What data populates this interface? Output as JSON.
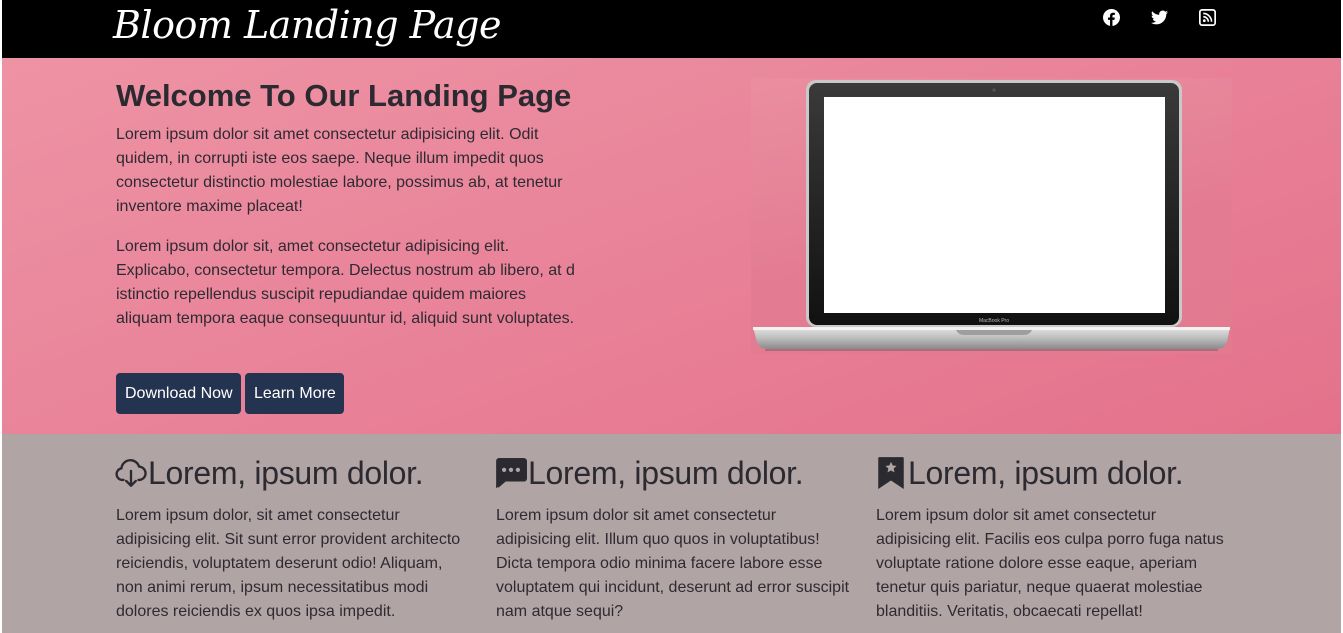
{
  "navbar": {
    "brand": "Bloom Landing Page",
    "social": [
      {
        "icon": "facebook-icon"
      },
      {
        "icon": "twitter-icon"
      },
      {
        "icon": "rss-icon"
      }
    ]
  },
  "hero": {
    "title": "Welcome To Our Landing Page",
    "paragraphs": [
      "Lorem ipsum dolor sit amet consectetur adipisicing elit. Odit quidem, in corrupti iste eos saepe. Neque illum impedit quos consectetur distinctio molestiae labore, possimus ab, at tenetur inventore maxime placeat!",
      "Lorem ipsum dolor sit, amet consectetur adipisicing elit. Explicabo, consectetur tempora. Delectus nostrum ab libero, at d istinctio repellendus suscipit repudiandae quidem maiores aliquam tempora eaque consequuntur id, aliquid sunt voluptates."
    ],
    "download_label": "Download Now",
    "learn_label": "Learn More",
    "image": {
      "icon": "laptop-illustration",
      "screen_label": "MacBook Pro"
    }
  },
  "features": [
    {
      "icon": "cloud-download-icon",
      "title": "Lorem, ipsum dolor.",
      "text": "Lorem ipsum dolor, sit amet consectetur adipisicing elit. Sit sunt error provident architecto reiciendis, voluptatem deserunt odio! Aliquam, non animi rerum, ipsum necessitatibus modi dolores reiciendis ex quos ipsa impedit."
    },
    {
      "icon": "chat-dots-icon",
      "title": "Lorem, ipsum dolor.",
      "text": "Lorem ipsum dolor sit amet consectetur adipisicing elit. Illum quo quos in voluptatibus! Dicta tempora odio minima facere labore esse voluptatem qui incidunt, deserunt ad error suscipit nam atque sequi?"
    },
    {
      "icon": "bookmark-star-icon",
      "title": "Lorem, ipsum dolor.",
      "text": "Lorem ipsum dolor sit amet consectetur adipisicing elit. Facilis eos culpa porro fuga natus voluptate ratione dolore esse eaque, aperiam tenetur quis pariatur, neque quaerat molestiae blanditiis. Veritatis, obcaecati repellat!"
    }
  ],
  "colors": {
    "navbar": "#000000",
    "hero_bg": "#e9849a",
    "features_bg": "#b1a4a4",
    "button": "#243450",
    "text": "#2b2a31"
  }
}
